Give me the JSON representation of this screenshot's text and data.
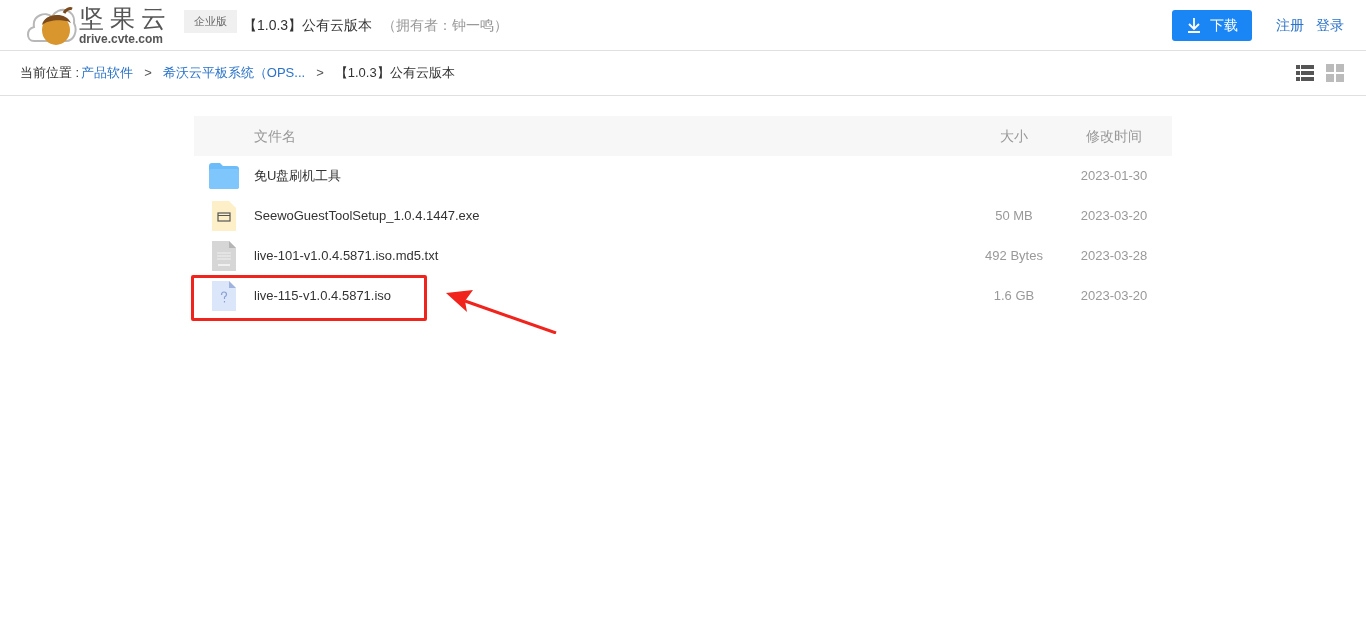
{
  "header": {
    "logo_name": "坚果云",
    "logo_domain": "drive.cvte.com",
    "edition_badge": "企业版",
    "title": "【1.0.3】公有云版本",
    "owner": "（拥有者：钟一鸣）",
    "download_button": "下载",
    "links": [
      "注册",
      "登录"
    ]
  },
  "breadcrumb": {
    "label": "当前位置 :",
    "items": [
      {
        "text": "产品软件",
        "kind": "link"
      },
      {
        "text": "希沃云平板系统（OPS...",
        "kind": "link"
      },
      {
        "text": "【1.0.3】公有云版本",
        "kind": "current"
      }
    ],
    "separator": ">"
  },
  "view_modes": [
    {
      "kind": "list",
      "selected": true
    },
    {
      "kind": "grid",
      "selected": false
    }
  ],
  "table": {
    "columns": [
      "文件名",
      "大小",
      "修改时间"
    ],
    "rows": [
      {
        "kind": "folder",
        "name": "免U盘刷机工具",
        "size": "",
        "modified": "2023-01-30",
        "highlighted": false
      },
      {
        "kind": "exe",
        "name": "SeewoGuestToolSetup_1.0.4.1447.exe",
        "size": "50 MB",
        "modified": "2023-03-20",
        "highlighted": false
      },
      {
        "kind": "txt",
        "name": "live-101-v1.0.4.5871.iso.md5.txt",
        "size": "492 Bytes",
        "modified": "2023-03-28",
        "highlighted": false
      },
      {
        "kind": "unknown",
        "name": "live-115-v1.0.4.5871.iso",
        "size": "1.6 GB",
        "modified": "2023-03-20",
        "highlighted": true
      }
    ]
  }
}
